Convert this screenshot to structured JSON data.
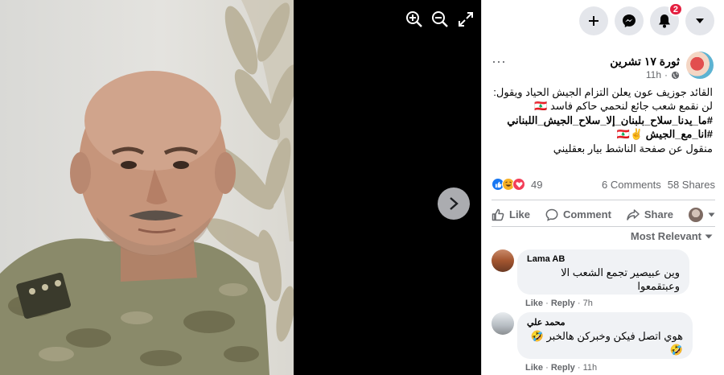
{
  "viewer": {
    "tools": [
      {
        "name": "zoom-in-icon"
      },
      {
        "name": "zoom-out-icon"
      },
      {
        "name": "fullscreen-icon"
      }
    ]
  },
  "topbar": {
    "notifications_badge": "2"
  },
  "post": {
    "page_name": "ثورة ١٧ تشرين",
    "time": "11h",
    "lines": [
      "القائد جوزيف عون يعلن التزام الجيش الحياد ويقول:",
      "لن نقمع شعب جائع لنحمي حاكم فاسد 🇱🇧",
      "#ما_يدنا_سلاح_بلبنان_إلا_سلاح_الجيش_اللبناني",
      "#انا_مع_الجيش ✌🇱🇧",
      "منقول عن صفحة الناشط بيار بعقليني"
    ],
    "reaction_count": "49",
    "comments_count": "6 Comments",
    "shares_count": "58 Shares"
  },
  "actions": {
    "like": "Like",
    "comment": "Comment",
    "share": "Share"
  },
  "sort_label": "Most Relevant",
  "comments": [
    {
      "author": "Lama AB",
      "text_line1": "وين عبيصير تجمع الشعب الا",
      "text_line2": "وعبتقمعوا",
      "like": "Like",
      "reply": "Reply",
      "time": "7h"
    },
    {
      "author": "محمد علي",
      "text_line1": "هوي اتصل فيكن وخبركن هالخبر 🤣",
      "text_line2": "🤣",
      "like": "Like",
      "reply": "Reply",
      "time": "11h"
    }
  ],
  "colors": {
    "accent_red": "#e41e3f",
    "facebook_blue": "#1877f2",
    "muted_text": "#65676b"
  }
}
